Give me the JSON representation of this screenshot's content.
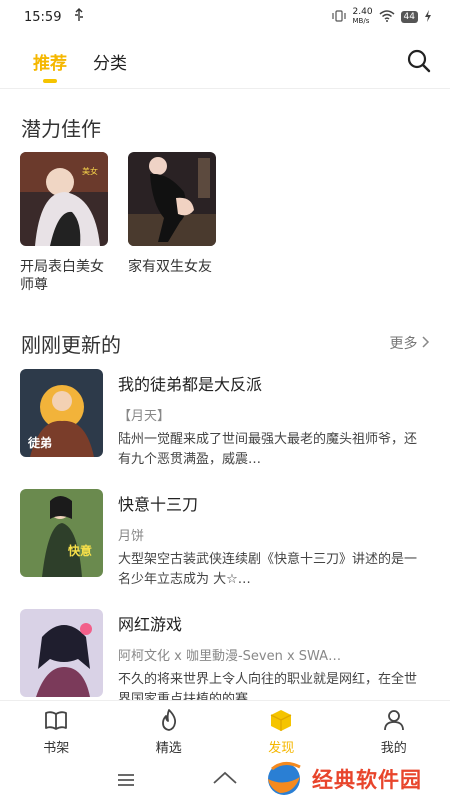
{
  "status": {
    "time": "15:59",
    "net_speed_top": "2.40",
    "net_speed_bottom": "MB/s",
    "battery": "44"
  },
  "nav": {
    "tabs": [
      "推荐",
      "分类"
    ]
  },
  "sections": {
    "potential_title": "潜力佳作",
    "updated_title": "刚刚更新的",
    "more_label": "更多"
  },
  "potential": [
    {
      "title": "开局表白美女师尊"
    },
    {
      "title": "家有双生女友"
    }
  ],
  "updated": [
    {
      "title": "我的徒弟都是大反派",
      "author": "【月天】",
      "desc": "陆州一觉醒来成了世间最强大最老的魔头祖师爷，还有九个恶贯满盈，威震…"
    },
    {
      "title": "快意十三刀",
      "author": "月饼",
      "desc": "大型架空古装武侠连续剧《快意十三刀》讲述的是一名少年立志成为 大☆…"
    },
    {
      "title": "网红游戏",
      "author": "阿柯文化 x 咖里動漫-Seven x SWA…",
      "desc": "不久的将来世界上令人向往的职业就是网红，在全世界国家重点扶植的的赛…"
    }
  ],
  "bottom_nav": [
    {
      "label": "书架",
      "icon": "book-icon"
    },
    {
      "label": "精选",
      "icon": "flame-icon"
    },
    {
      "label": "发现",
      "icon": "cube-icon"
    },
    {
      "label": "我的",
      "icon": "person-icon"
    }
  ],
  "watermark": "经典软件园",
  "colors": {
    "accent": "#f5c400",
    "watermark": "#e8452c"
  }
}
